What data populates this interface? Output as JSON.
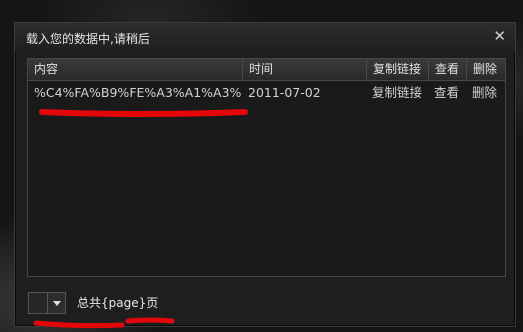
{
  "dialog": {
    "title": "载入您的数据中,请稍后",
    "close_glyph": "✕"
  },
  "table": {
    "headers": {
      "content": "内容",
      "time": "时间",
      "copy": "复制链接",
      "view": "查看",
      "delete": "删除"
    },
    "rows": [
      {
        "content": "%C4%FA%B9%FE%A3%A1%A3%",
        "time": "2011-07-02",
        "copy": "复制链接",
        "view": "查看",
        "delete": "删除"
      }
    ]
  },
  "footer": {
    "page_select_value": "",
    "pager_text": "总共{page}页"
  },
  "colors": {
    "annotation": "#e3060a",
    "dialog_bg": "#1e1e1e"
  }
}
